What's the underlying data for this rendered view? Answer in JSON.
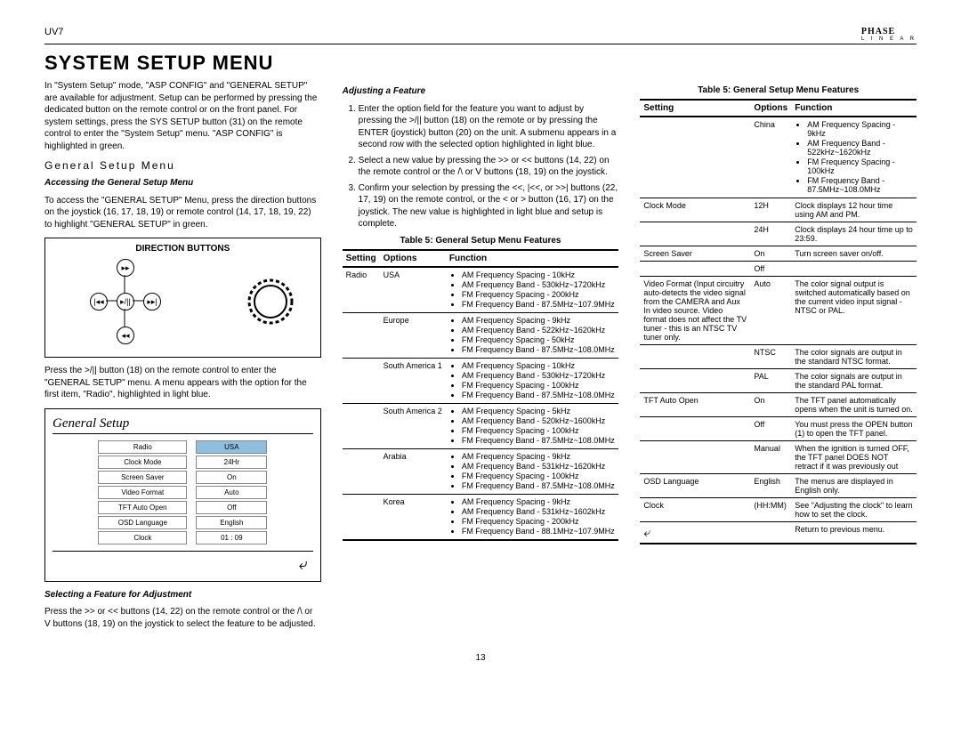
{
  "header": {
    "model": "UV7",
    "brand": "PHASE",
    "brand_sub": "L I N E A R"
  },
  "title": "SYSTEM SETUP MENU",
  "intro": "In \"System Setup\" mode, \"ASP CONFIG\" and \"GENERAL SETUP\" are available for adjustment. Setup can be performed by pressing the dedicated button on the remote control or on the front panel. For system settings, press the SYS SETUP button (31) on the remote control to enter the \"System Setup\" menu. \"ASP CONFIG\" is highlighted in green.",
  "gsm_head": "General Setup Menu",
  "accessing_head": "Accessing the General Setup Menu",
  "accessing_text": "To access the \"GENERAL SETUP\" Menu, press the direction buttons on the joystick (16, 17, 18, 19) or remote control (14, 17, 18, 19, 22) to highlight \"GENERAL SETUP\" in green.",
  "direction_title": "DIRECTION BUTTONS",
  "after_dir": "Press the >/|| button (18) on the remote control to enter the \"GENERAL SETUP\" menu. A menu appears with the option for the first item, \"Radio\", highlighted in light blue.",
  "gs_title": "General Setup",
  "gs_rows": [
    {
      "label": "Radio",
      "value": "USA",
      "selected": true
    },
    {
      "label": "Clock Mode",
      "value": "24Hr"
    },
    {
      "label": "Screen Saver",
      "value": "On"
    },
    {
      "label": "Video Format",
      "value": "Auto"
    },
    {
      "label": "TFT Auto Open",
      "value": "Off"
    },
    {
      "label": "OSD Language",
      "value": "English"
    },
    {
      "label": "Clock",
      "value": "01 : 09"
    }
  ],
  "selecting_head": "Selecting a Feature for Adjustment",
  "selecting_text": "Press the >> or << buttons (14, 22) on the remote control or the /\\ or V buttons (18, 19) on the joystick to select the feature to be adjusted.",
  "adjusting_head": "Adjusting a Feature",
  "steps": [
    "Enter the option field for the feature you want to adjust by pressing the >/|| button (18) on the remote or by pressing the ENTER (joystick) button (20) on the unit. A submenu appears in a second row with the selected option highlighted in light blue.",
    "Select a new value by pressing the >> or << buttons (14, 22) on the remote control or the /\\ or V buttons (18, 19) on the joystick.",
    "Confirm your selection by pressing the <<, |<<, or >>| buttons (22, 17, 19) on the remote control, or the < or > button (16, 17) on the joystick. The new value is highlighted in light blue and setup is complete."
  ],
  "table_caption": "Table 5: General Setup Menu Features",
  "table_headers": {
    "setting": "Setting",
    "options": "Options",
    "function": "Function"
  },
  "table1": [
    {
      "setting": "Radio",
      "option": "USA",
      "func": [
        "AM Frequency Spacing - 10kHz",
        "AM Frequency Band - 530kHz~1720kHz",
        "FM Frequency Spacing - 200kHz",
        "FM Frequency Band - 87.5MHz~107.9MHz"
      ]
    },
    {
      "setting": "",
      "option": "Europe",
      "func": [
        "AM Frequency Spacing - 9kHz",
        "AM Frequency Band - 522kHz~1620kHz",
        "FM Frequency Spacing - 50kHz",
        "FM Frequency Band - 87.5MHz~108.0MHz"
      ]
    },
    {
      "setting": "",
      "option": "South America 1",
      "func": [
        "AM Frequency Spacing - 10kHz",
        "AM Frequency Band - 530kHz~1720kHz",
        "FM Frequency Spacing - 100kHz",
        "FM Frequency Band - 87.5MHz~108.0MHz"
      ]
    },
    {
      "setting": "",
      "option": "South America 2",
      "func": [
        "AM Frequency Spacing - 5kHz",
        "AM Frequency Band - 520kHz~1600kHz",
        "FM Frequency Spacing - 100kHz",
        "FM Frequency Band - 87.5MHz~108.0MHz"
      ]
    },
    {
      "setting": "",
      "option": "Arabia",
      "func": [
        "AM Frequency Spacing - 9kHz",
        "AM Frequency Band - 531kHz~1620kHz",
        "FM Frequency Spacing - 100kHz",
        "FM Frequency Band - 87.5MHz~108.0MHz"
      ]
    },
    {
      "setting": "",
      "option": "Korea",
      "func": [
        "AM Frequency Spacing - 9kHz",
        "AM Frequency Band - 531kHz~1602kHz",
        "FM Frequency Spacing - 200kHz",
        "FM Frequency Band - 88.1MHz~107.9MHz"
      ]
    }
  ],
  "table2": [
    {
      "setting": "",
      "option": "China",
      "func": [
        "AM Frequency Spacing - 9kHz",
        "AM Frequency Band - 522kHz~1620kHz",
        "FM Frequency Spacing - 100kHz",
        "FM Frequency Band - 87.5MHz~108.0MHz"
      ]
    },
    {
      "setting": "Clock Mode",
      "option": "12H",
      "functext": "Clock displays 12 hour time using AM and PM."
    },
    {
      "setting": "",
      "option": "24H",
      "functext": "Clock displays 24 hour time up to 23:59."
    },
    {
      "setting": "Screen Saver",
      "option": "On",
      "functext": "Turn screen saver on/off."
    },
    {
      "setting": "",
      "option": "Off",
      "functext": ""
    },
    {
      "setting": "Video Format (Input circuitry auto-detects the video signal from the CAMERA and Aux In video source. Video format does not affect the TV tuner - this is an NTSC TV tuner only.",
      "option": "Auto",
      "functext": "The color signal output is switched automatically based on the current video input signal - NTSC or PAL."
    },
    {
      "setting": "",
      "option": "NTSC",
      "functext": "The color signals are output in the standard NTSC format."
    },
    {
      "setting": "",
      "option": "PAL",
      "functext": "The color signals are output in the standard PAL format."
    },
    {
      "setting": "TFT Auto Open",
      "option": "On",
      "functext": "The TFT panel automatically opens when the unit is turned on."
    },
    {
      "setting": "",
      "option": "Off",
      "functext": "You must press the OPEN button (1) to open the TFT panel."
    },
    {
      "setting": "",
      "option": "Manual",
      "functext": "When the ignition is turned OFF, the TFT panel DOES NOT retract if it was previously out"
    },
    {
      "setting": "OSD Language",
      "option": "English",
      "functext": "The menus are displayed in English only."
    },
    {
      "setting": "Clock",
      "option": "(HH:MM)",
      "functext": "See \"Adjusting the clock\" to learn how to set the clock."
    },
    {
      "setting": "↩",
      "option": "",
      "functext": "Return to previous menu."
    }
  ],
  "page_num": "13"
}
